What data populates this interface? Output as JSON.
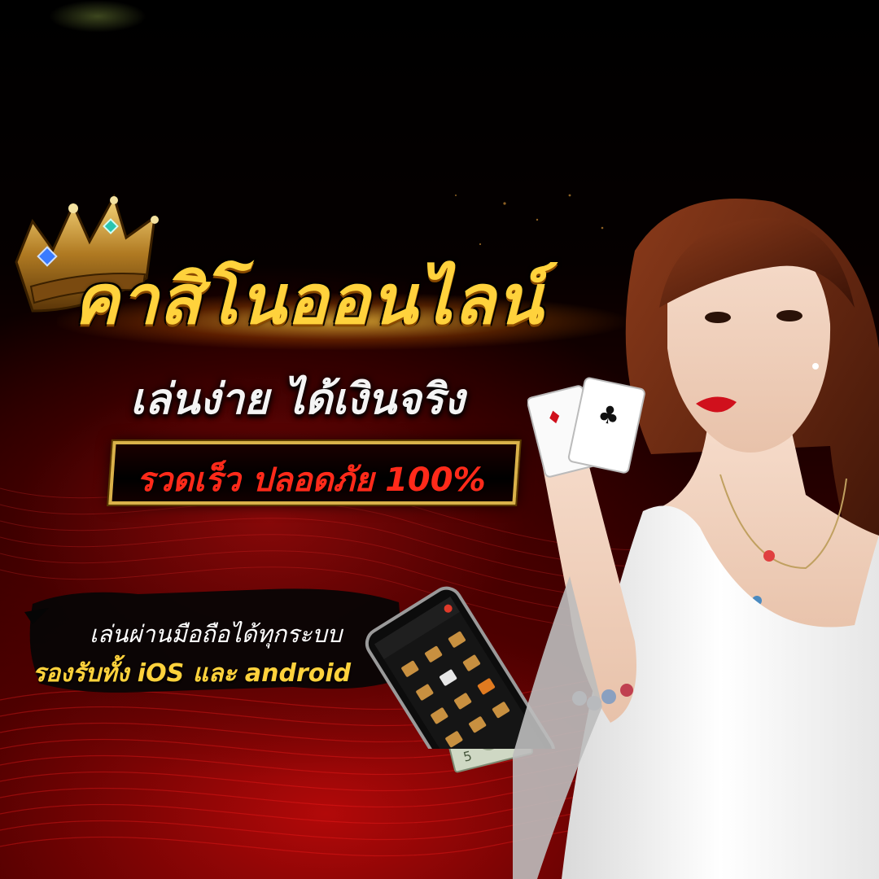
{
  "headline": "คาสิโนออนไลน์",
  "subheadline": "เล่นง่าย ได้เงินจริง",
  "badge": "รวดเร็ว ปลอดภัย 100%",
  "mobile": {
    "line1": "เล่นผ่านมือถือได้ทุกระบบ",
    "line2": "รองรับทั้ง iOS และ android"
  },
  "icons": {
    "crown": "crown-icon",
    "phone": "smartphone-icon",
    "cards": "playing-cards-icon",
    "money": "banknote-icon"
  },
  "colors": {
    "gold": "#ffd23c",
    "red": "#ff2a1a",
    "background": "#000000",
    "accent_red": "#b00000",
    "frame_gold": "#d9b24a"
  }
}
